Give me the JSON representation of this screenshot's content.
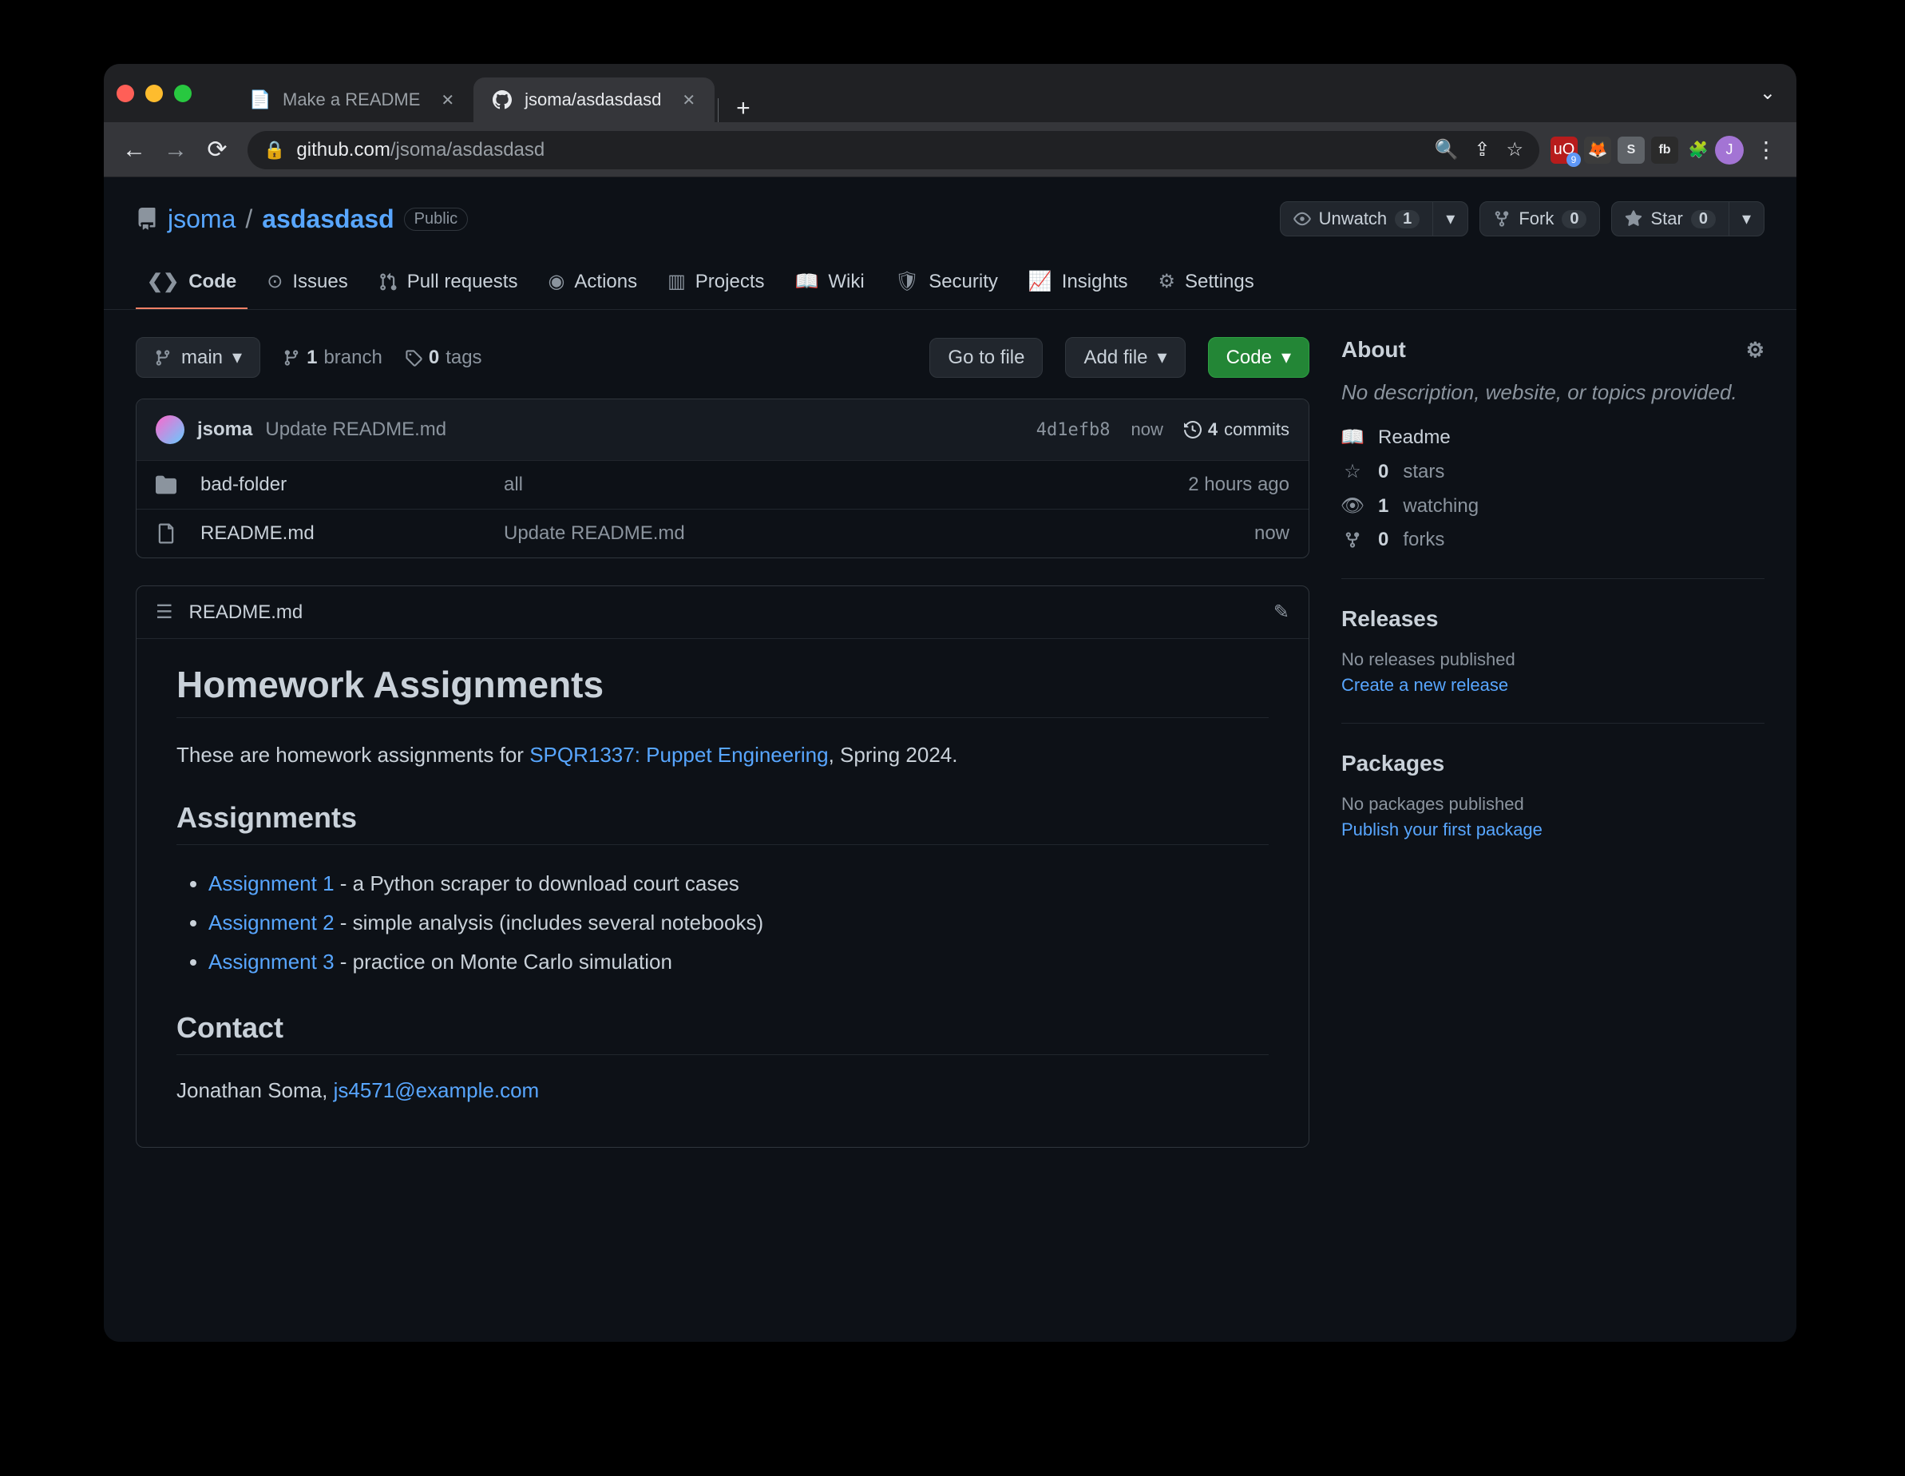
{
  "browser": {
    "tabs": [
      {
        "title": "Make a README",
        "active": false
      },
      {
        "title": "jsoma/asdasdasd",
        "active": true
      }
    ],
    "url_display_host": "github.com",
    "url_display_path": "/jsoma/asdasdasd",
    "avatar_letter": "J"
  },
  "repo": {
    "owner": "jsoma",
    "name": "asdasdasd",
    "visibility": "Public",
    "unwatch_label": "Unwatch",
    "unwatch_count": "1",
    "fork_label": "Fork",
    "fork_count": "0",
    "star_label": "Star",
    "star_count": "0"
  },
  "tabs": {
    "code": "Code",
    "issues": "Issues",
    "pulls": "Pull requests",
    "actions": "Actions",
    "projects": "Projects",
    "wiki": "Wiki",
    "security": "Security",
    "insights": "Insights",
    "settings": "Settings"
  },
  "toolbar": {
    "branch": "main",
    "branch_count": "1",
    "branch_word": "branch",
    "tag_count": "0",
    "tag_word": "tags",
    "go_to_file": "Go to file",
    "add_file": "Add file",
    "code_btn": "Code"
  },
  "commit": {
    "user": "jsoma",
    "message": "Update README.md",
    "hash": "4d1efb8",
    "time": "now",
    "count": "4",
    "count_word": "commits"
  },
  "files": [
    {
      "type": "dir",
      "name": "bad-folder",
      "msg": "all",
      "when": "2 hours ago"
    },
    {
      "type": "file",
      "name": "README.md",
      "msg": "Update README.md",
      "when": "now"
    }
  ],
  "readme": {
    "filename": "README.md",
    "h1": "Homework Assignments",
    "intro_pre": "These are homework assignments for ",
    "intro_link": "SPQR1337: Puppet Engineering",
    "intro_post": ", Spring 2024.",
    "h2_assign": "Assignments",
    "items": [
      {
        "link": "Assignment 1",
        "rest": " - a Python scraper to download court cases"
      },
      {
        "link": "Assignment 2",
        "rest": " - simple analysis (includes several notebooks)"
      },
      {
        "link": "Assignment 3",
        "rest": " - practice on Monte Carlo simulation"
      }
    ],
    "h2_contact": "Contact",
    "contact_name": "Jonathan Soma, ",
    "contact_email": "js4571@example.com"
  },
  "sidebar": {
    "about": "About",
    "desc": "No description, website, or topics provided.",
    "readme": "Readme",
    "stars_n": "0",
    "stars_w": "stars",
    "watch_n": "1",
    "watch_w": "watching",
    "forks_n": "0",
    "forks_w": "forks",
    "releases": "Releases",
    "releases_none": "No releases published",
    "releases_new": "Create a new release",
    "packages": "Packages",
    "packages_none": "No packages published",
    "packages_new": "Publish your first package"
  }
}
